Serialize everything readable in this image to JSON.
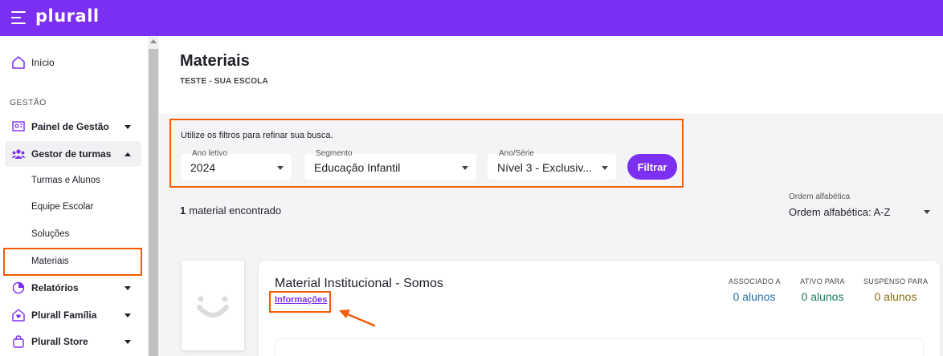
{
  "app": {
    "logo": "plurall"
  },
  "sidebar": {
    "home": "Início",
    "section_gestao": "GESTÃO",
    "items": [
      {
        "label": "Painel de Gestão"
      },
      {
        "label": "Gestor de turmas"
      },
      {
        "label": "Relatórios"
      },
      {
        "label": "Plurall Família"
      },
      {
        "label": "Plurall Store"
      }
    ],
    "subitems": [
      {
        "label": "Turmas e Alunos"
      },
      {
        "label": "Equipe Escolar"
      },
      {
        "label": "Soluções"
      },
      {
        "label": "Materiais"
      }
    ]
  },
  "header": {
    "title": "Materiais",
    "subtitle": "TESTE - SUA ESCOLA"
  },
  "filters": {
    "hint": "Utilize os filtros para refinar sua busca.",
    "ano": {
      "label": "Ano letivo",
      "value": "2024"
    },
    "segmento": {
      "label": "Segmento",
      "value": "Educação Infantil"
    },
    "serie": {
      "label": "Ano/Série",
      "value": "Nível 3 - Exclusiv..."
    },
    "button": "Filtrar"
  },
  "results": {
    "count": "1",
    "count_text": "material encontrado",
    "sort_label": "Ordem alfabética",
    "sort_value": "Ordem alfabética: A-Z"
  },
  "material": {
    "title": "Material Institucional - Somos",
    "info_link": "Informações",
    "stats": [
      {
        "label": "ASSOCIADO A",
        "value": "0 alunos",
        "color": "#1f6fa3"
      },
      {
        "label": "ATIVO PARA",
        "value": "0 alunos",
        "color": "#1a7a5e"
      },
      {
        "label": "SUSPENSO PARA",
        "value": "0 alunos",
        "color": "#8a6d12"
      }
    ]
  },
  "colors": {
    "brand": "#7b2ff0",
    "highlight": "#f25c05"
  }
}
